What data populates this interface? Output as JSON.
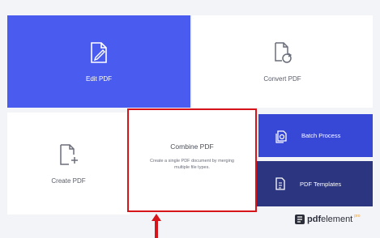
{
  "tiles": {
    "edit": {
      "label": "Edit PDF",
      "icon": "edit-pdf-icon"
    },
    "convert": {
      "label": "Convert PDF",
      "icon": "convert-pdf-icon"
    },
    "create": {
      "label": "Create PDF",
      "icon": "create-pdf-icon"
    },
    "combine": {
      "label": "Combine PDF",
      "description": "Create a single PDF document by merging multiple file types."
    },
    "batch": {
      "label": "Batch Process",
      "icon": "batch-process-icon"
    },
    "templates": {
      "label": "PDF Templates",
      "icon": "pdf-templates-icon"
    }
  },
  "brand": {
    "pdf": "pdf",
    "element": "element",
    "edition": "pro"
  },
  "colors": {
    "accent_blue": "#4a5cf0",
    "batch_blue": "#3747d6",
    "templates_navy": "#2b3580",
    "highlight_red": "#d7141a"
  }
}
